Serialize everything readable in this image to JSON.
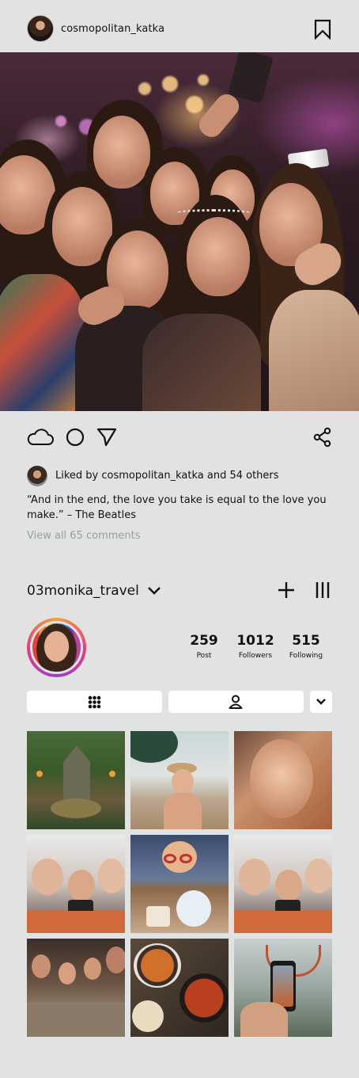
{
  "post": {
    "author": "cosmopolitan_katka",
    "liked_by_text": "Liked by cosmopolitan_katka and 54 others",
    "caption": "“And in the end, the love you take is equal to the love you make.” – The Beatles",
    "view_comments": "View all 65 comments",
    "icons": [
      "cloud-icon",
      "circle-icon",
      "send-icon",
      "share-icon",
      "bookmark-icon"
    ]
  },
  "profile": {
    "username": "03monika_travel",
    "stats": [
      {
        "value": "259",
        "label": "Post"
      },
      {
        "value": "1012",
        "label": "Followers"
      },
      {
        "value": "515",
        "label": "Following"
      }
    ],
    "tabs": [
      "grid-icon",
      "tagged-person-icon",
      "chevron-down-icon"
    ],
    "grid_items": [
      "jungle-temple-photo",
      "beach-woman-photo",
      "smiling-woman-closeup",
      "girls-selfie-photo",
      "cartoon-characters-photo",
      "girls-selfie-photo-2",
      "restaurant-group-photo",
      "food-dishes-photo",
      "phone-photo-basketball"
    ]
  },
  "colors": {
    "background": "#e0e3e2",
    "text": "#111111",
    "muted": "#9a9d9e",
    "story_ring": "#e2407a"
  }
}
